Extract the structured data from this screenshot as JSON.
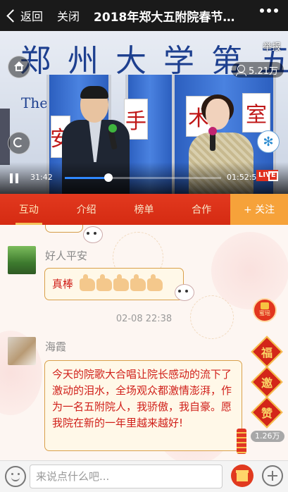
{
  "nav": {
    "back_label": "返回",
    "close_label": "关闭",
    "title": "2018年郑大五附院春节…"
  },
  "video": {
    "report_label": "举报",
    "view_count": "5.21万",
    "current_time": "31:42",
    "duration": "01:52:55",
    "progress": 0.28,
    "live_badge": "LIVE",
    "banner_text": "郑州大学第五",
    "banner_en": "The",
    "signs": [
      "安",
      "手",
      "术",
      "室"
    ]
  },
  "tabs": {
    "items": [
      {
        "label": "互动",
        "active": true
      },
      {
        "label": "介绍",
        "active": false
      },
      {
        "label": "榜单",
        "active": false
      },
      {
        "label": "合作",
        "active": false
      }
    ],
    "follow_label": "+ 关注"
  },
  "chat": {
    "messages": [
      {
        "nickname": "好人平安",
        "text": "真棒"
      },
      {
        "timestamp": "02-08 22:38"
      },
      {
        "nickname": "海霞",
        "text": "今天的院歌大合唱让院长感动的流下了激动的泪水，全场观众都激情澎湃，作为一名五附院人，我骄傲，我自豪。愿我院在新的一年里越来越好!"
      }
    ],
    "side": {
      "envelope_label": "蜜瑶",
      "blessings": [
        "福",
        "邀",
        "赞"
      ],
      "count_badge": "1.26万"
    }
  },
  "input": {
    "placeholder": "来说点什么吧..."
  },
  "colors": {
    "tab_bar": "#d52b12",
    "follow": "#f6a23a",
    "message_text": "#d0201a",
    "bubble_border": "#d9a04a"
  }
}
